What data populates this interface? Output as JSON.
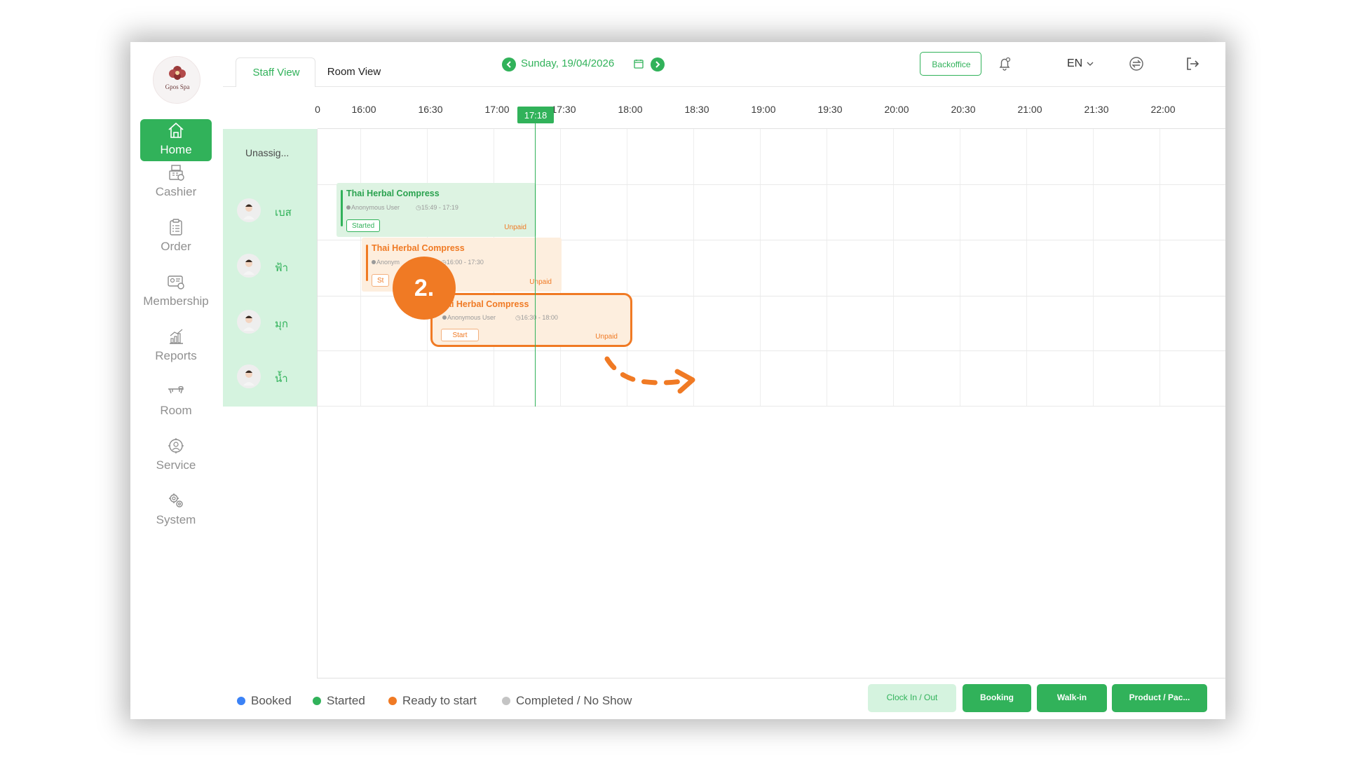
{
  "logo": {
    "text": "Gpos Spa"
  },
  "sidebar": {
    "items": [
      {
        "label": "Home",
        "icon": "home-icon",
        "active": true
      },
      {
        "label": "Cashier",
        "icon": "cashier-icon"
      },
      {
        "label": "Order",
        "icon": "clipboard-icon"
      },
      {
        "label": "Membership",
        "icon": "membership-card-icon"
      },
      {
        "label": "Reports",
        "icon": "bar-chart-icon"
      },
      {
        "label": "Room",
        "icon": "massage-bed-icon"
      },
      {
        "label": "Service",
        "icon": "service-icon"
      },
      {
        "label": "System",
        "icon": "gears-icon"
      }
    ]
  },
  "tabs": {
    "staff_view": "Staff View",
    "room_view": "Room View"
  },
  "date": {
    "label": "Sunday, 19/04/2026"
  },
  "header": {
    "backoffice": "Backoffice",
    "language": "EN"
  },
  "timeline": {
    "first_partial": "0",
    "labels": [
      "16:00",
      "16:30",
      "17:00",
      "17:30",
      "18:00",
      "18:30",
      "19:00",
      "19:30",
      "20:00",
      "20:30",
      "21:00",
      "21:30",
      "22:00"
    ],
    "now": "17:18"
  },
  "staff": {
    "unassigned": "Unassig...",
    "rows": [
      {
        "name": "เบส"
      },
      {
        "name": "ฟ้า"
      },
      {
        "name": "มุก"
      },
      {
        "name": "น้ำ"
      }
    ]
  },
  "bookings": [
    {
      "service": "Thai Herbal Compress",
      "customer": "Anonymous User",
      "time": "15:49 - 17:19",
      "status": "Started",
      "payment": "Unpaid"
    },
    {
      "service": "Thai Herbal Compress",
      "customer": "Anonym",
      "time": "16:00 - 17:30",
      "status": "St",
      "payment": "Unpaid"
    },
    {
      "service": "ai Herbal Compress",
      "customer": "Anonymous User",
      "time": "16:30 - 18:00",
      "status": "Start",
      "payment": "Unpaid"
    }
  ],
  "step_marker": "2.",
  "legend": [
    {
      "label": "Booked",
      "color": "#3b82f6"
    },
    {
      "label": "Started",
      "color": "#31b25a"
    },
    {
      "label": "Ready to start",
      "color": "#f07a24"
    },
    {
      "label": "Completed / No Show",
      "color": "#c4c4c4"
    }
  ],
  "footer": {
    "clock": "Clock In / Out",
    "booking": "Booking",
    "walkin": "Walk-in",
    "product": "Product / Pac..."
  },
  "colors": {
    "accent": "#31b25a",
    "ready": "#f07a24",
    "staff_bg": "#d5f3df"
  }
}
